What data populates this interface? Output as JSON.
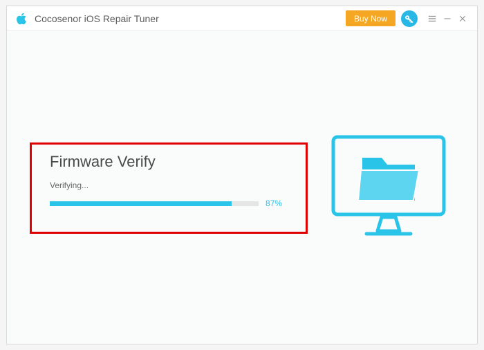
{
  "app": {
    "title": "Cocosenor iOS Repair Tuner"
  },
  "titlebar": {
    "buy_now_label": "Buy Now"
  },
  "main": {
    "heading": "Firmware Verify",
    "status_text": "Verifying...",
    "progress_percent_label": "87%",
    "progress_value": 87
  },
  "colors": {
    "accent": "#29c4e8",
    "buy_now": "#f5a623",
    "highlight": "#e10000"
  }
}
